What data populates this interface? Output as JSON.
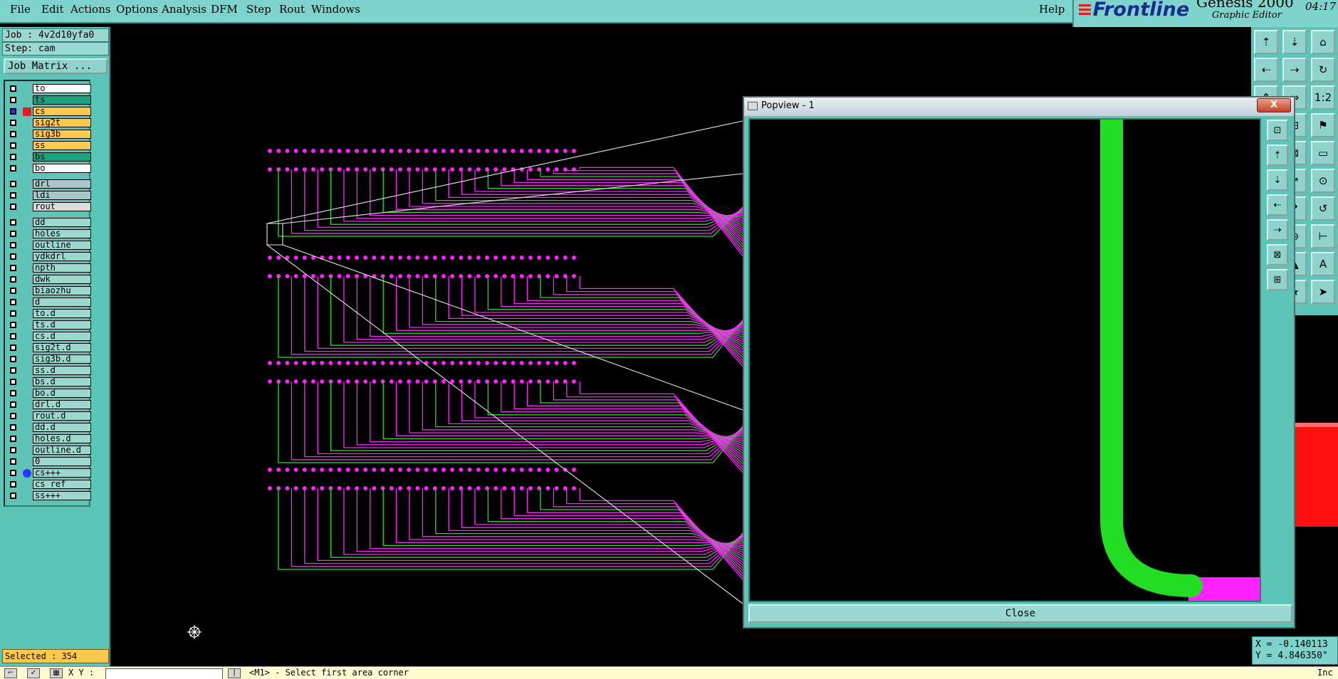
{
  "menu": {
    "items": [
      "File",
      "Edit",
      "Actions",
      "Options",
      "Analysis",
      "DFM",
      "Step",
      "Rout",
      "Windows"
    ],
    "help": "Help"
  },
  "brand": {
    "logo": "Frontline",
    "product": "Genesis 2000",
    "subtitle": "Graphic Editor",
    "time": "04:17"
  },
  "job": {
    "job_label": "Job : 4v2d10yfa0",
    "step_label": "Step: cam",
    "matrix_button": "Job Matrix ..."
  },
  "layers": [
    {
      "name": "to",
      "color": "#ffffff"
    },
    {
      "name": "ts",
      "color": "#1aa37f"
    },
    {
      "name": "cs",
      "color": "#ffc94d",
      "active": true
    },
    {
      "name": "sig2t",
      "color": "#ffc94d"
    },
    {
      "name": "sig3b",
      "color": "#ffc94d"
    },
    {
      "name": "ss",
      "color": "#ffc94d"
    },
    {
      "name": "bs",
      "color": "#1aa37f"
    },
    {
      "name": "bo",
      "color": "#ffffff"
    },
    {
      "name": "drl",
      "color": "#a7c7cc",
      "gap": true
    },
    {
      "name": "ldi",
      "color": "#a7c7cc"
    },
    {
      "name": "rout",
      "color": "#dcdcdc"
    },
    {
      "name": "dd",
      "color": "#9bd8d2",
      "gap": true
    },
    {
      "name": "holes",
      "color": "#9bd8d2"
    },
    {
      "name": "outline",
      "color": "#9bd8d2"
    },
    {
      "name": "ydkdrl",
      "color": "#9bd8d2"
    },
    {
      "name": "npth",
      "color": "#9bd8d2"
    },
    {
      "name": "dwk",
      "color": "#9bd8d2"
    },
    {
      "name": "biaozhu",
      "color": "#9bd8d2"
    },
    {
      "name": "d",
      "color": "#9bd8d2"
    },
    {
      "name": "to.d",
      "color": "#9bd8d2"
    },
    {
      "name": "ts.d",
      "color": "#9bd8d2"
    },
    {
      "name": "cs.d",
      "color": "#9bd8d2"
    },
    {
      "name": "sig2t.d",
      "color": "#9bd8d2"
    },
    {
      "name": "sig3b.d",
      "color": "#9bd8d2"
    },
    {
      "name": "ss.d",
      "color": "#9bd8d2"
    },
    {
      "name": "bs.d",
      "color": "#9bd8d2"
    },
    {
      "name": "bo.d",
      "color": "#9bd8d2"
    },
    {
      "name": "drl.d",
      "color": "#9bd8d2"
    },
    {
      "name": "rout.d",
      "color": "#9bd8d2"
    },
    {
      "name": "dd.d",
      "color": "#9bd8d2"
    },
    {
      "name": "holes.d",
      "color": "#9bd8d2"
    },
    {
      "name": "outline.d",
      "color": "#9bd8d2"
    },
    {
      "name": "0",
      "color": "#9bd8d2"
    },
    {
      "name": "cs+++",
      "color": "#9bd8d2",
      "marker": "#1f3cff"
    },
    {
      "name": "cs_ref",
      "color": "#9bd8d2"
    },
    {
      "name": "ss+++",
      "color": "#9bd8d2"
    }
  ],
  "status": {
    "selected": "Selected : 354",
    "xy_label": "X Y :",
    "prompt": "<M1> - Select first area corner",
    "right_stub": "Inc"
  },
  "coords": {
    "x": "X = -0.140113",
    "y": "Y = 4.846350\""
  },
  "popview": {
    "title": "Popview - 1",
    "close_x": "X",
    "close_button": "Close"
  },
  "colors": {
    "background": "#000000",
    "panel": "#5fc4b8",
    "pad": "#ff22ff",
    "trace": "#ff22ff",
    "green_trace": "#22dd22",
    "zoom_lines": "#e8e8e8"
  }
}
